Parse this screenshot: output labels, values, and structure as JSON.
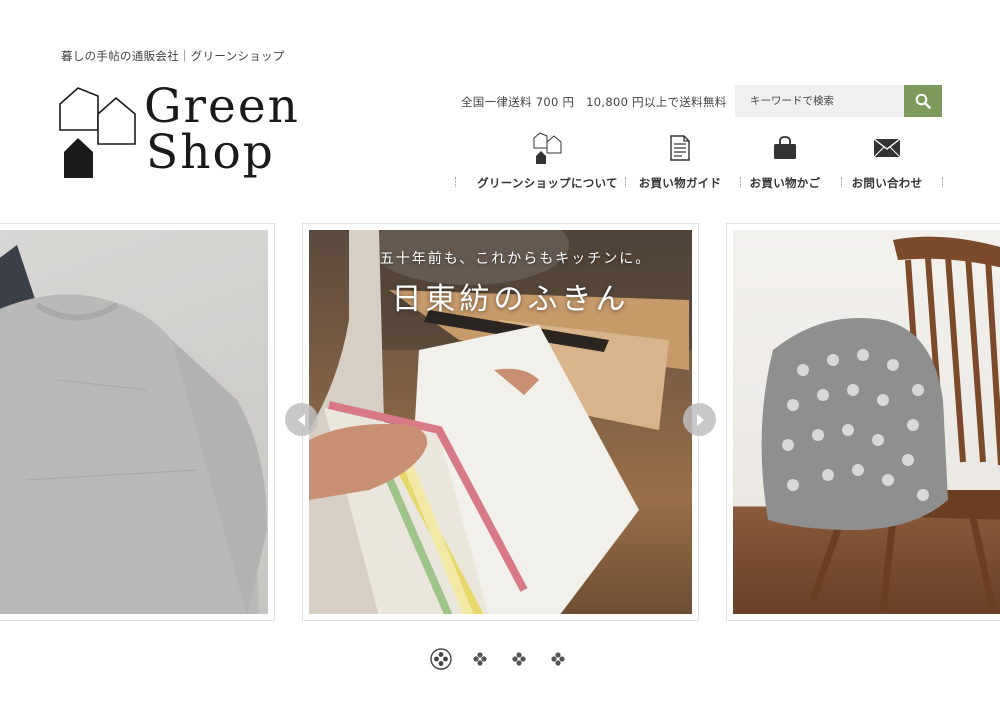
{
  "header": {
    "tagline": "暮しの手帖の通販会社｜グリーンショップ",
    "logo_line1": "Green",
    "logo_line2": "Shop",
    "shipping": "全国一律送料 700 円　10,800 円以上で送料無料"
  },
  "search": {
    "placeholder": "キーワードで検索",
    "button_icon": "search-icon",
    "button_color": "#7c9a5a"
  },
  "nav": {
    "items": [
      {
        "label": "グリーンショップについて",
        "icon": "houses-icon"
      },
      {
        "label": "お買い物ガイド",
        "icon": "document-icon"
      },
      {
        "label": "お買い物かご",
        "icon": "shopping-bag-icon"
      },
      {
        "label": "お問い合わせ",
        "icon": "envelope-icon"
      }
    ]
  },
  "slider": {
    "slides": [
      {
        "subject": "gray-sweater"
      },
      {
        "subject": "kitchen-towels",
        "caption_sub": "五十年前も、これからもキッチンに。",
        "caption_main": "日東紡のふきん"
      },
      {
        "subject": "blanket-on-chair"
      }
    ],
    "active_index": 1,
    "dot_count": 4,
    "active_dot": 0
  }
}
